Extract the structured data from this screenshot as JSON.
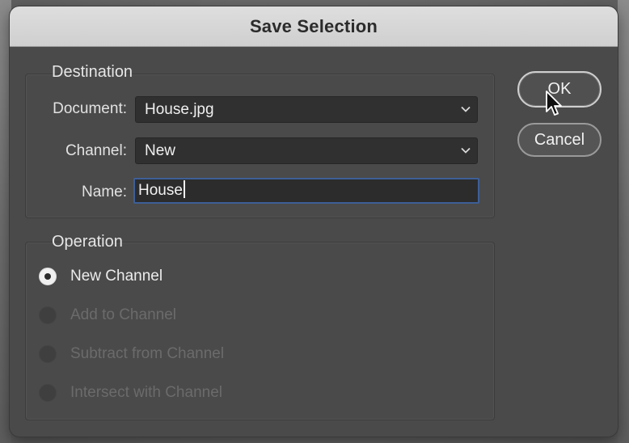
{
  "dialog": {
    "title": "Save Selection"
  },
  "destination": {
    "group_label": "Destination",
    "document_label": "Document:",
    "document_value": "House.jpg",
    "channel_label": "Channel:",
    "channel_value": "New",
    "name_label": "Name:",
    "name_value": "House"
  },
  "operation": {
    "group_label": "Operation",
    "options": [
      {
        "label": "New Channel",
        "selected": true,
        "enabled": true
      },
      {
        "label": "Add to Channel",
        "selected": false,
        "enabled": false
      },
      {
        "label": "Subtract from Channel",
        "selected": false,
        "enabled": false
      },
      {
        "label": "Intersect with Channel",
        "selected": false,
        "enabled": false
      }
    ]
  },
  "buttons": {
    "ok_label": "OK",
    "cancel_label": "Cancel"
  },
  "icons": {
    "dropdown": "chevron-down-icon",
    "cursor": "mouse-pointer-icon"
  },
  "colors": {
    "dialog_bg": "#4a4a4a",
    "titlebar_bg": "#d9d9d9",
    "focus_border": "#3d5f97"
  }
}
